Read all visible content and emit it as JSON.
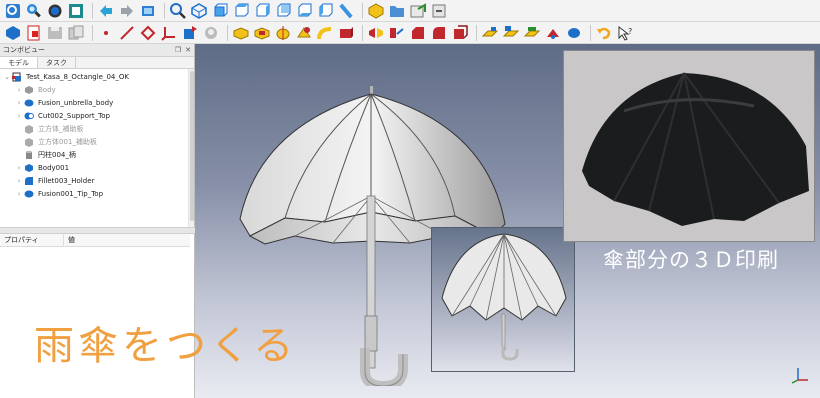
{
  "left_panel": {
    "title": "コンボビュー",
    "header_icons": [
      "restore-icon",
      "close-icon"
    ],
    "tabs": [
      {
        "label": "モデル",
        "active": true
      },
      {
        "label": "タスク",
        "active": false
      }
    ],
    "tree": [
      {
        "label": "Test_Kasa_8_Octangle_04_OK",
        "level": 0,
        "expanded": true,
        "icon": "document-icon",
        "dim": false
      },
      {
        "label": "Body",
        "level": 1,
        "icon": "body-icon",
        "dim": true
      },
      {
        "label": "Fusion_unbrella_body",
        "level": 1,
        "icon": "fusion-icon",
        "dim": false
      },
      {
        "label": "Cut002_Support_Top",
        "level": 1,
        "icon": "cut-icon",
        "dim": false
      },
      {
        "label": "立方体_補助板",
        "level": 1,
        "icon": "cube-icon",
        "dim": true,
        "no_arrow": true
      },
      {
        "label": "立方体001_補助板",
        "level": 1,
        "icon": "cube-icon",
        "dim": true,
        "no_arrow": true
      },
      {
        "label": "円柱004_柄",
        "level": 1,
        "icon": "cylinder-icon",
        "dim": false,
        "no_arrow": true
      },
      {
        "label": "Body001",
        "level": 1,
        "icon": "body-icon",
        "dim": false
      },
      {
        "label": "Fillet003_Holder",
        "level": 1,
        "icon": "fillet-icon",
        "dim": false
      },
      {
        "label": "Fusion001_Tip_Top",
        "level": 1,
        "icon": "fusion-icon",
        "dim": false
      }
    ],
    "properties": {
      "col_property": "プロパティ",
      "col_value": "値"
    }
  },
  "viewport": {
    "caption": "傘部分の３Ｄ印刷",
    "title": "雨傘をつくる",
    "title_color": "#f0a040"
  },
  "toolbar_icons_row1": [
    "std-view-icon",
    "zoom-icon",
    "draw-style-icon",
    "bounding-box-icon",
    "back-icon",
    "forward-icon",
    "workbench-icon",
    "zoom-select-icon",
    "iso-icon",
    "front-icon",
    "top-icon",
    "right-icon",
    "rear-icon",
    "bottom-icon",
    "left-icon",
    "measure-icon",
    "part-icon",
    "folder-icon",
    "link-icon",
    "macro-icon"
  ],
  "toolbar_icons_row2": [
    "body-icon",
    "new-doc-icon",
    "save-icon",
    "copy-icon",
    "point-icon",
    "line-icon",
    "plane-icon",
    "lcs-icon",
    "shape-binder-icon",
    "clone-icon",
    "pad-icon",
    "pocket-icon",
    "revolution-icon",
    "groove-icon",
    "additive-pipe-icon",
    "subtractive-icon",
    "mirror-icon",
    "pattern-icon",
    "chamfer-icon",
    "fillet-icon",
    "boolean-icon",
    "draft-icon",
    "thickness-icon",
    "undo-icon",
    "whatsthis-icon"
  ]
}
